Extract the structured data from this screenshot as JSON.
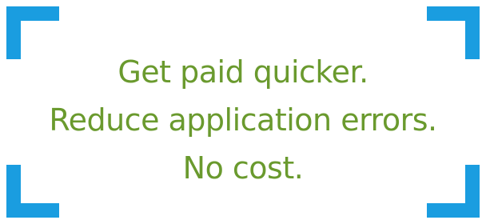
{
  "colors": {
    "accent_blue": "#1a9de0",
    "text_green": "#6a9a2e",
    "background": "#ffffff"
  },
  "message": {
    "line1": "Get paid quicker.",
    "line2": "Reduce application errors.",
    "line3": "No cost."
  }
}
